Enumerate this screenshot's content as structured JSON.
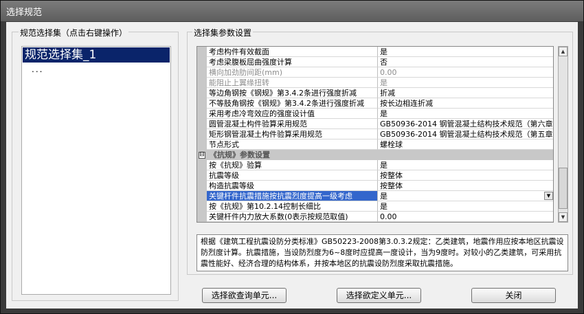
{
  "window": {
    "title": "选择规范"
  },
  "left_panel": {
    "title": "规范选择集（点击右键操作）",
    "selected_item": "规范选择集_1",
    "more_indicator": "..."
  },
  "right_panel": {
    "title": "选择集参数设置",
    "rows_top": [
      {
        "name": "考虑构件有效截面",
        "value": "是",
        "disabled": false
      },
      {
        "name": "考虑梁腹板屈曲强度计算",
        "value": "否",
        "disabled": false
      },
      {
        "name": "横向加劲肋间距(mm)",
        "value": "0.00",
        "disabled": true
      },
      {
        "name": "能阻止上翼缘扭转",
        "value": "是",
        "disabled": true
      },
      {
        "name": "等边角钢按《钢规》第3.4.2条进行强度折减",
        "value": "折减",
        "disabled": false
      },
      {
        "name": "不等肢角钢按《钢规》第3.4.2条进行强度折减",
        "value": "按长边相连折减",
        "disabled": false
      },
      {
        "name": "采用考虑冷弯效应的强度设计值",
        "value": "是",
        "disabled": false
      },
      {
        "name": "圆管混凝土构件验算采用规范",
        "value": "GB50936-2014 钢管混凝土结构技术规范（第六章",
        "disabled": false
      },
      {
        "name": "矩形钢管混凝土构件验算采用规范",
        "value": "GB50936-2014 钢管混凝土结构技术规范（第五章",
        "disabled": false
      },
      {
        "name": "节点形式",
        "value": "螺栓球",
        "disabled": false
      }
    ],
    "category": {
      "toggle": "⊟",
      "label": "《抗规》参数设置"
    },
    "rows_bottom": [
      {
        "name": "按《抗规》验算",
        "value": "是"
      },
      {
        "name": "抗震等级",
        "value": "按整体"
      },
      {
        "name": "构造抗震等级",
        "value": "按整体"
      },
      {
        "name": "关键杆件抗震措施按抗震烈度提高一级考虑",
        "value": "是",
        "selected": true
      },
      {
        "name": "按《抗规》第10.2.14控制长细比",
        "value": "是"
      },
      {
        "name": "关键杆件内力放大系数(0表示按规范取值)",
        "value": "0.00"
      }
    ],
    "description": "根据《建筑工程抗震设防分类标准》GB50223-2008第3.0.3.2规定：乙类建筑，地震作用应按本地区抗震设防烈度计算。抗震措施，当设防烈度为6~8度时应提高一度设计，当为9度时。对较小的乙类建筑，可采用抗震性能好、经济合理的结构体系，并按本地区的抗震设防烈度采取抗震措施。"
  },
  "buttons": {
    "query": "选择欲查询单元...",
    "define": "选择欲定义单元...",
    "close": "关闭"
  }
}
